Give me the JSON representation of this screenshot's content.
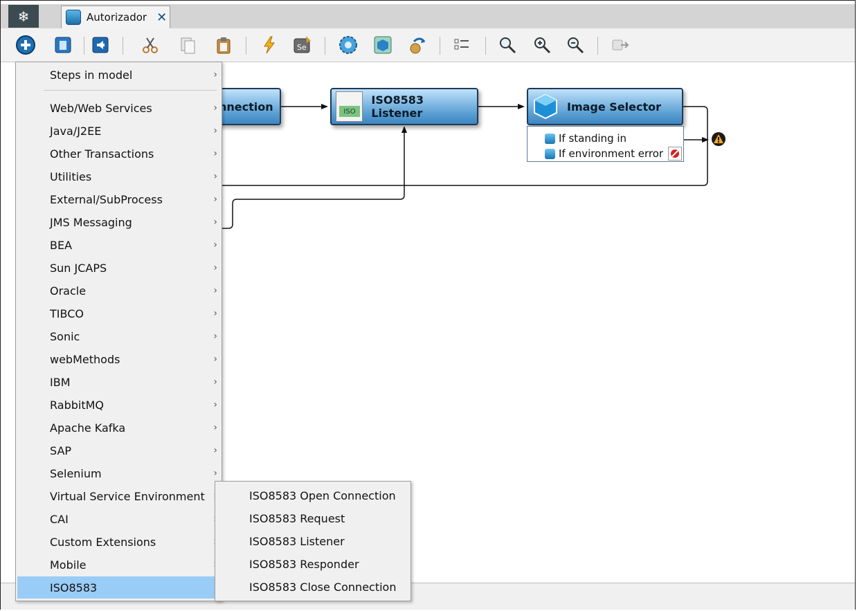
{
  "tab": {
    "title": "Autorizador",
    "close": "✕"
  },
  "toolbar": {
    "icons": [
      "add-icon",
      "delete-icon",
      "back-icon",
      "cut-icon",
      "copy-icon",
      "paste-icon",
      "lightning-icon",
      "selenium-icon",
      "gear-icon",
      "cube-icon",
      "undo-icon",
      "list-icon",
      "zoom-icon",
      "zoom-in-icon",
      "zoom-out-icon",
      "export-icon"
    ]
  },
  "diagram": {
    "nodes": [
      {
        "label": "nnection"
      },
      {
        "label": "ISO8583 Listener",
        "badge": "ISO"
      },
      {
        "label": "Image Selector"
      }
    ],
    "branches": [
      "If standing in",
      "If environment error"
    ]
  },
  "menu": {
    "items": [
      {
        "label": "Steps in model"
      },
      {
        "label": "Web/Web Services"
      },
      {
        "label": "Java/J2EE"
      },
      {
        "label": "Other Transactions"
      },
      {
        "label": "Utilities"
      },
      {
        "label": "External/SubProcess"
      },
      {
        "label": "JMS Messaging"
      },
      {
        "label": "BEA"
      },
      {
        "label": "Sun JCAPS"
      },
      {
        "label": "Oracle"
      },
      {
        "label": "TIBCO"
      },
      {
        "label": "Sonic"
      },
      {
        "label": "webMethods"
      },
      {
        "label": "IBM"
      },
      {
        "label": "RabbitMQ"
      },
      {
        "label": "Apache Kafka"
      },
      {
        "label": "SAP"
      },
      {
        "label": "Selenium"
      },
      {
        "label": "Virtual Service Environment"
      },
      {
        "label": "CAI"
      },
      {
        "label": "Custom Extensions"
      },
      {
        "label": "Mobile"
      },
      {
        "label": "ISO8583"
      }
    ],
    "selected": "ISO8583"
  },
  "submenu": {
    "items": [
      "ISO8583 Open Connection",
      "ISO8583 Request",
      "ISO8583 Listener",
      "ISO8583 Responder",
      "ISO8583 Close Connection"
    ]
  },
  "colors": {
    "selected_item": "#99ccf6",
    "node_fill": "#5a9fd3",
    "tab_close": "#1c4b84"
  }
}
